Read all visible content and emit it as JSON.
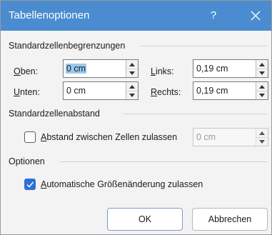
{
  "dialog": {
    "title": "Tabellenoptionen",
    "help_label": "?",
    "close_icon": "close-icon"
  },
  "sections": {
    "margins_title": "Standardzellenbegrenzungen",
    "spacing_title": "Standardzellenabstand",
    "options_title": "Optionen"
  },
  "margins": {
    "top": {
      "label_acc": "O",
      "label_rest": "ben:",
      "value": "0 cm"
    },
    "bottom": {
      "label_acc": "U",
      "label_rest": "nten:",
      "value": "0 cm"
    },
    "left": {
      "label_acc": "L",
      "label_rest": "inks:",
      "value": "0,19 cm"
    },
    "right": {
      "label_acc": "R",
      "label_rest": "echts:",
      "value": "0,19 cm"
    }
  },
  "spacing": {
    "checkbox_acc": "A",
    "checkbox_rest": "bstand zwischen Zellen zulassen",
    "checked": false,
    "value": "0 cm",
    "enabled": false
  },
  "options": {
    "autofit_acc": "A",
    "autofit_rest": "utomatische Größenänderung zulassen",
    "checked": true
  },
  "buttons": {
    "ok": "OK",
    "cancel": "Abbrechen"
  },
  "colors": {
    "titlebar": "#4a8ccf",
    "checkbox_checked": "#2f6fd6",
    "selection": "#99c9ef"
  }
}
